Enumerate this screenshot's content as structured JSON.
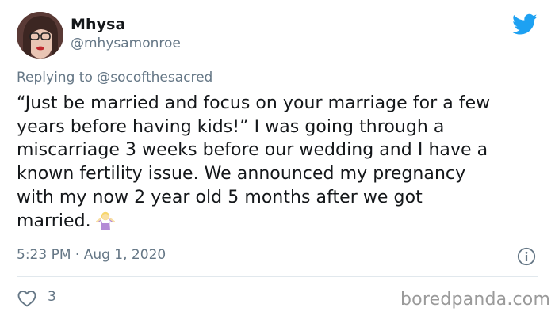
{
  "tweet": {
    "author": {
      "display_name": "Mhysa",
      "handle": "@mhysamonroe"
    },
    "replying_prefix": "Replying to ",
    "replying_to": "@socofthesacred",
    "lines": [
      "“Just be married and focus on your marriage for a few",
      "years before having kids!” I was going through a",
      "miscarriage 3 weeks before our wedding and I have a",
      "known fertility issue. We announced my pregnancy",
      "with my now 2 year old 5 months after we got",
      "married."
    ],
    "timestamp": "5:23 PM · Aug 1, 2020",
    "likes": "3"
  },
  "watermark": "boredpanda.com",
  "icons": {
    "logo": "twitter-bird-icon",
    "info": "info-icon",
    "like": "heart-icon",
    "emoji": "person-shrugging-emoji"
  },
  "colors": {
    "brand": "#1da1f2",
    "text": "#14171a",
    "secondary": "#657786",
    "divider": "#e1e8ed",
    "watermark": "#9a9a9a"
  }
}
